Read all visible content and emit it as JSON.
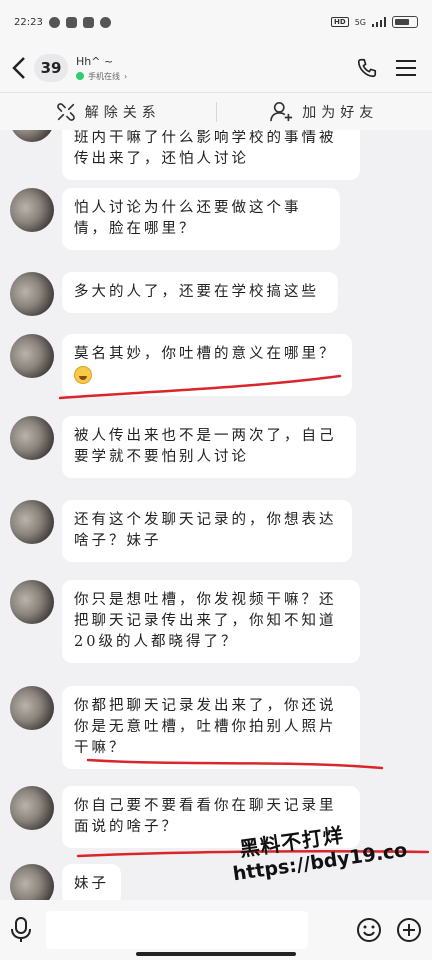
{
  "status_bar": {
    "time": "22:23",
    "network": "HD",
    "signal": "5G"
  },
  "header": {
    "unread_count": "39",
    "contact_name": "Hh^ ~",
    "presence": "手机在线"
  },
  "actions": {
    "unfriend": "解除关系",
    "add_friend": "加为好友"
  },
  "messages": [
    {
      "text": "班内干嘛了什么影响学校的事情被传出来了，还怕人讨论"
    },
    {
      "text": "怕人讨论为什么还要做这个事情，脸在哪里？"
    },
    {
      "text": "多大的人了，还要在学校搞这些"
    },
    {
      "text": "莫名其妙，你吐槽的意义在哪里？",
      "emoji": "smile-emoji"
    },
    {
      "text": "被人传出来也不是一两次了，自己要学就不要怕别人讨论"
    },
    {
      "text": "还有这个发聊天记录的，你想表达啥子？妹子"
    },
    {
      "text": "你只是想吐槽，你发视频干嘛？还把聊天记录传出来了，你知不知道20级的人都晓得了？"
    },
    {
      "text": "你都把聊天记录发出来了，你还说你是无意吐槽，吐槽你拍别人照片干嘛？"
    },
    {
      "text": "你自己要不要看看你在聊天记录里面说的啥子？"
    },
    {
      "text": "妹子"
    }
  ],
  "watermark": {
    "line1": "黑料不打烊",
    "line2": "https://bdy19.co"
  },
  "colors": {
    "annotation": "#d9262c",
    "background": "#f1f1f3",
    "bubble": "#ffffff"
  }
}
